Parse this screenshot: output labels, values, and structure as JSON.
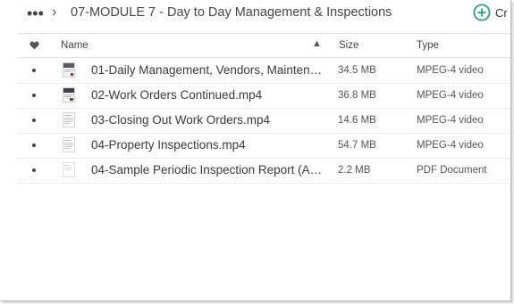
{
  "header": {
    "folder_title": "07-MODULE 7 - Day to Day Management & Inspections",
    "more_glyph": "•••",
    "separator_glyph": "›",
    "create_label": "Cr",
    "accent_color": "#2aa37a"
  },
  "columns": {
    "name": "Name",
    "sort_glyph": "▲",
    "size": "Size",
    "type": "Type"
  },
  "files": [
    {
      "name": "01-Daily Management, Vendors, Maintenance ...",
      "size": "34.5 MB",
      "type": "MPEG-4 video",
      "thumb": "video"
    },
    {
      "name": "02-Work Orders Continued.mp4",
      "size": "36.8 MB",
      "type": "MPEG-4 video",
      "thumb": "video"
    },
    {
      "name": "03-Closing Out Work Orders.mp4",
      "size": "14.6 MB",
      "type": "MPEG-4 video",
      "thumb": "doc"
    },
    {
      "name": "04-Property Inspections.mp4",
      "size": "54.7 MB",
      "type": "MPEG-4 video",
      "thumb": "doc"
    },
    {
      "name": "04-Sample Periodic Inspection Report (Address...",
      "size": "2.2 MB",
      "type": "PDF Document",
      "thumb": "pdf"
    }
  ]
}
